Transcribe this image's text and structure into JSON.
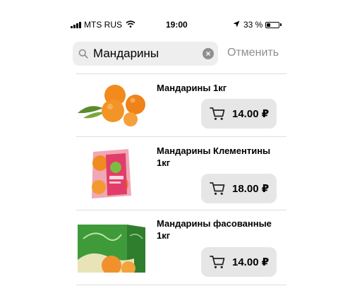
{
  "status_bar": {
    "carrier": "MTS RUS",
    "time": "19:00",
    "battery": "33 %",
    "battery_level": 0.33
  },
  "search": {
    "query": "Мандарины",
    "cancel_label": "Отменить"
  },
  "products": [
    {
      "name": "Мандарины 1кг",
      "price": "14.00 ₽"
    },
    {
      "name": "Мандарины Клементины 1кг",
      "price": "18.00 ₽"
    },
    {
      "name": "Мандарины фасованные 1кг",
      "price": "14.00 ₽"
    }
  ],
  "colors": {
    "cancel_text": "#8e8e93",
    "search_bg": "#eeeeef",
    "button_bg": "#e6e6e6"
  },
  "icons": {
    "search": "search-icon",
    "clear": "clear-icon",
    "cart": "cart-icon",
    "location": "location-arrow-icon"
  }
}
